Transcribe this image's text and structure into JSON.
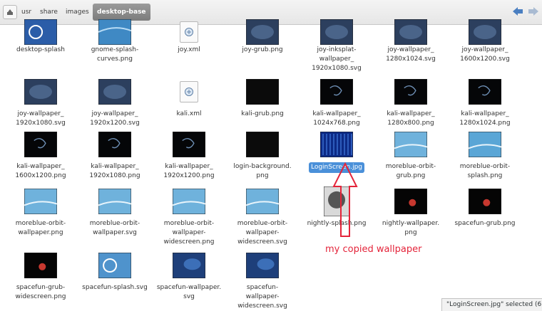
{
  "breadcrumb": {
    "segments": [
      "usr",
      "share",
      "images",
      "desktop-base"
    ],
    "active_index": 3
  },
  "files": [
    {
      "name": "desktop-splash",
      "thumb": "debian-swirl"
    },
    {
      "name": "gnome-splash-\ncurves.png",
      "thumb": "blue-curves"
    },
    {
      "name": "joy.xml",
      "thumb": "xml-doc"
    },
    {
      "name": "joy-grub.png",
      "thumb": "dark-blue"
    },
    {
      "name": "joy-inksplat-\nwallpaper_\n1920x1080.svg",
      "thumb": "dark-blue"
    },
    {
      "name": "joy-wallpaper_\n1280x1024.svg",
      "thumb": "dark-blue"
    },
    {
      "name": "joy-wallpaper_\n1600x1200.svg",
      "thumb": "dark-blue"
    },
    {
      "name": "joy-wallpaper_\n1920x1080.svg",
      "thumb": "dark-blue"
    },
    {
      "name": "joy-wallpaper_\n1920x1200.svg",
      "thumb": "dark-blue"
    },
    {
      "name": "kali.xml",
      "thumb": "xml-doc"
    },
    {
      "name": "kali-grub.png",
      "thumb": "black"
    },
    {
      "name": "kali-wallpaper_\n1024x768.png",
      "thumb": "black-dragon"
    },
    {
      "name": "kali-wallpaper_\n1280x800.png",
      "thumb": "black-dragon"
    },
    {
      "name": "kali-wallpaper_\n1280x1024.png",
      "thumb": "black-dragon"
    },
    {
      "name": "kali-wallpaper_\n1600x1200.png",
      "thumb": "black-dragon"
    },
    {
      "name": "kali-wallpaper_\n1920x1080.png",
      "thumb": "black-dragon"
    },
    {
      "name": "kali-wallpaper_\n1920x1200.png",
      "thumb": "black-dragon"
    },
    {
      "name": "login-background.\npng",
      "thumb": "black"
    },
    {
      "name": "LoginScreen.jpg",
      "thumb": "blue-matrix",
      "selected": true
    },
    {
      "name": "moreblue-orbit-\ngrub.png",
      "thumb": "light-blue"
    },
    {
      "name": "moreblue-orbit-\nsplash.png",
      "thumb": "light-blue-swirl"
    },
    {
      "name": "moreblue-orbit-\nwallpaper.png",
      "thumb": "light-blue"
    },
    {
      "name": "moreblue-orbit-\nwallpaper.svg",
      "thumb": "light-blue"
    },
    {
      "name": "moreblue-orbit-\nwallpaper-\nwidescreen.png",
      "thumb": "light-blue"
    },
    {
      "name": "moreblue-orbit-\nwallpaper-\nwidescreen.svg",
      "thumb": "light-blue"
    },
    {
      "name": "nightly-splash.png",
      "thumb": "nightly"
    },
    {
      "name": "nightly-wallpaper.\npng",
      "thumb": "black-planet"
    },
    {
      "name": "spacefun-grub.png",
      "thumb": "black-planet"
    },
    {
      "name": "spacefun-grub-\nwidescreen.png",
      "thumb": "black-planet"
    },
    {
      "name": "spacefun-splash.svg",
      "thumb": "spacefun-splash"
    },
    {
      "name": "spacefun-wallpaper.\nsvg",
      "thumb": "deep-blue"
    },
    {
      "name": "spacefun-\nwallpaper-\nwidescreen.svg",
      "thumb": "deep-blue"
    }
  ],
  "annotation": "my copied wallpaper",
  "status_text": "\"LoginScreen.jpg\" selected (6",
  "colors": {
    "annotation": "#e4243a",
    "selection": "#4a90d9"
  }
}
